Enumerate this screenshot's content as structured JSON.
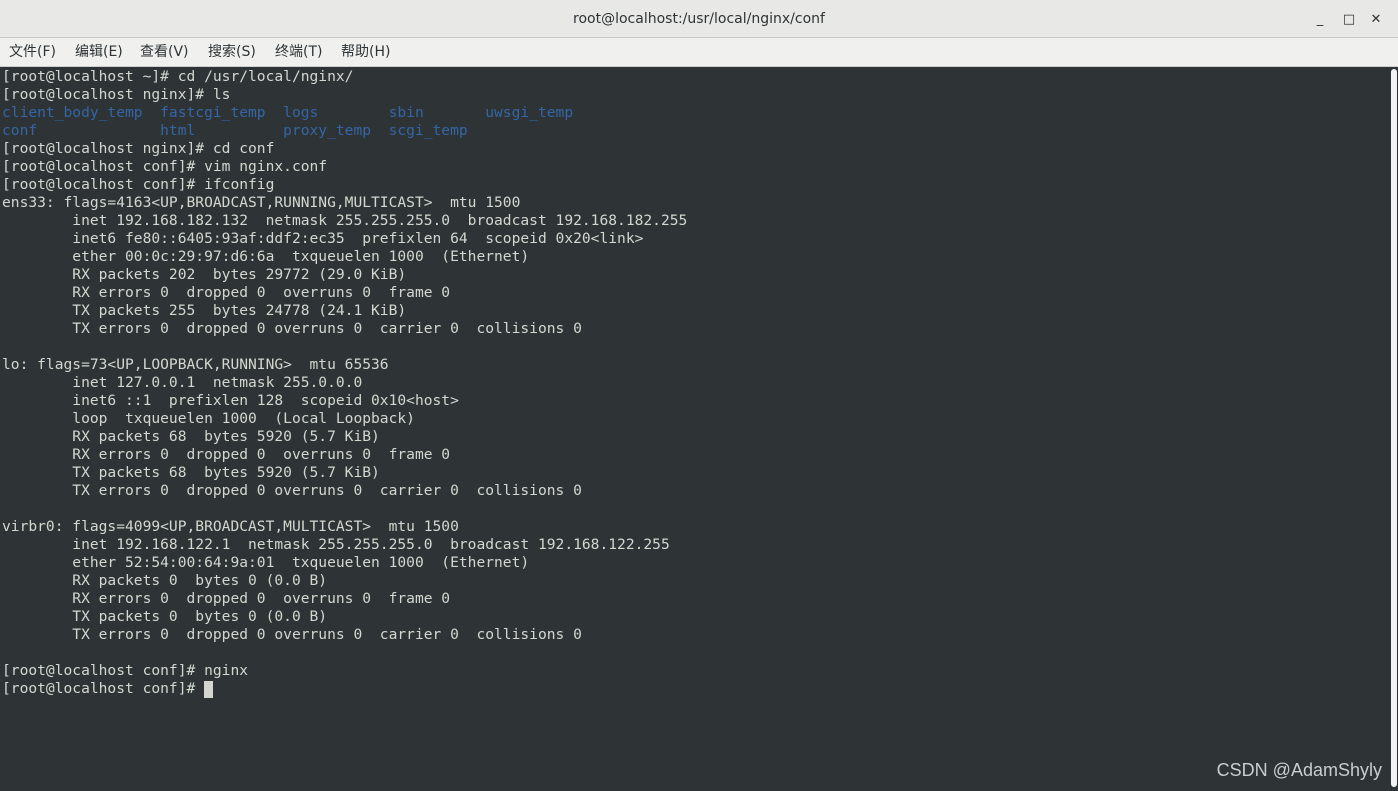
{
  "window": {
    "title": "root@localhost:/usr/local/nginx/conf",
    "minimize": "_",
    "maximize": "□",
    "close": "✕"
  },
  "menu": [
    "文件(F)",
    "编辑(E)",
    "查看(V)",
    "搜索(S)",
    "终端(T)",
    "帮助(H)"
  ],
  "terminal": {
    "lines": [
      "[root@localhost ~]# cd /usr/local/nginx/",
      "[root@localhost nginx]# ls",
      "client_body_temp  fastcgi_temp  logs        sbin       uwsgi_temp",
      "conf              html          proxy_temp  scgi_temp",
      "[root@localhost nginx]# cd conf",
      "[root@localhost conf]# vim nginx.conf",
      "[root@localhost conf]# ifconfig",
      "ens33: flags=4163<UP,BROADCAST,RUNNING,MULTICAST>  mtu 1500",
      "        inet 192.168.182.132  netmask 255.255.255.0  broadcast 192.168.182.255",
      "        inet6 fe80::6405:93af:ddf2:ec35  prefixlen 64  scopeid 0x20<link>",
      "        ether 00:0c:29:97:d6:6a  txqueuelen 1000  (Ethernet)",
      "        RX packets 202  bytes 29772 (29.0 KiB)",
      "        RX errors 0  dropped 0  overruns 0  frame 0",
      "        TX packets 255  bytes 24778 (24.1 KiB)",
      "        TX errors 0  dropped 0 overruns 0  carrier 0  collisions 0",
      "",
      "lo: flags=73<UP,LOOPBACK,RUNNING>  mtu 65536",
      "        inet 127.0.0.1  netmask 255.0.0.0",
      "        inet6 ::1  prefixlen 128  scopeid 0x10<host>",
      "        loop  txqueuelen 1000  (Local Loopback)",
      "        RX packets 68  bytes 5920 (5.7 KiB)",
      "        RX errors 0  dropped 0  overruns 0  frame 0",
      "        TX packets 68  bytes 5920 (5.7 KiB)",
      "        TX errors 0  dropped 0 overruns 0  carrier 0  collisions 0",
      "",
      "virbr0: flags=4099<UP,BROADCAST,MULTICAST>  mtu 1500",
      "        inet 192.168.122.1  netmask 255.255.255.0  broadcast 192.168.122.255",
      "        ether 52:54:00:64:9a:01  txqueuelen 1000  (Ethernet)",
      "        RX packets 0  bytes 0 (0.0 B)",
      "        RX errors 0  dropped 0  overruns 0  frame 0",
      "        TX packets 0  bytes 0 (0.0 B)",
      "        TX errors 0  dropped 0 overruns 0  carrier 0  collisions 0",
      "",
      "[root@localhost conf]# nginx",
      "[root@localhost conf]# "
    ],
    "blue_lines": [
      2,
      3
    ],
    "cursor_line": 34
  },
  "watermark": "CSDN @AdamShyly",
  "colors": {
    "background": "#2e3436",
    "foreground": "#d3d7cf",
    "directory": "#3465a4",
    "titlebar": "#e8e8e7"
  }
}
